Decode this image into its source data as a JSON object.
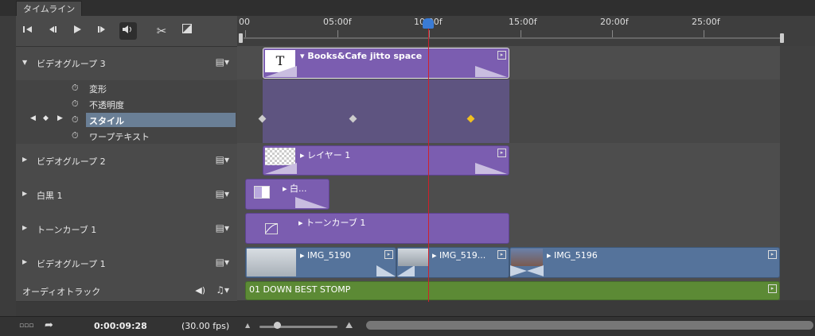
{
  "panel_tab": "タイムライン",
  "transport": {
    "buttons": [
      "go-to-first-frame",
      "previous-frame",
      "play",
      "next-frame",
      "audio",
      "split",
      "transition"
    ]
  },
  "ruler": {
    "labels": [
      "00",
      "05:00f",
      "10:00f",
      "15:00f",
      "20:00f",
      "25:00f"
    ]
  },
  "layers": {
    "video_group_3": "ビデオグループ 3",
    "prop_transform": "変形",
    "prop_opacity": "不透明度",
    "prop_style": "スタイル",
    "prop_warp_text": "ワープテキスト",
    "video_group_2": "ビデオグループ 2",
    "bw1": "白黒 1",
    "tone_curve1": "トーンカーブ 1",
    "video_group_1": "ビデオグループ 1",
    "audio_track": "オーディオトラック"
  },
  "clips": {
    "text_clip": "Books&Cafe jitto space",
    "text_glyph": "T",
    "layer1": "レイヤー 1",
    "bw_clip": "白...",
    "tone_clip": "トーンカーブ 1",
    "img1": "IMG_5190",
    "img2": "IMG_519...",
    "img3": "IMG_5196",
    "audio_clip": "01 DOWN BEST STOMP"
  },
  "status": {
    "timecode": "0:00:09:28",
    "fps": "(30.00 fps)"
  },
  "colors": {
    "playhead": "#d0202a",
    "clip_purple": "#7b5db0",
    "clip_blue": "#55739b",
    "clip_green": "#5c8a35",
    "keyframe_selected": "#f0c020"
  }
}
